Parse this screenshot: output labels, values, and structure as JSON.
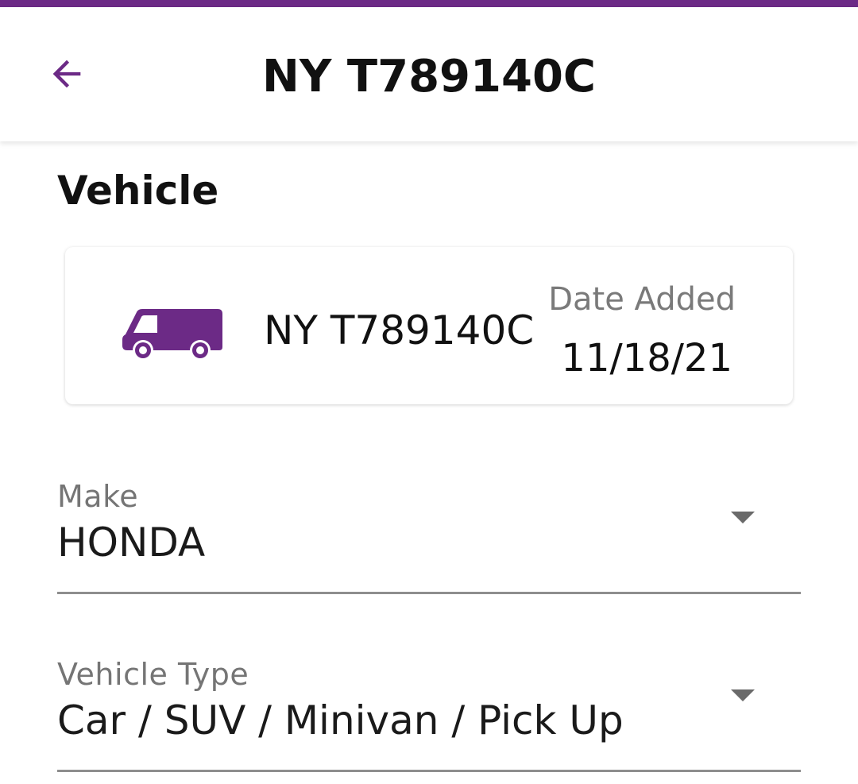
{
  "colors": {
    "brand": "#6c2a86",
    "text": "#111111",
    "muted": "#757575"
  },
  "header": {
    "back_icon": "arrow-left-icon",
    "title": "NY T789140C"
  },
  "section": {
    "title": "Vehicle"
  },
  "vehicle_card": {
    "icon": "van-icon",
    "plate": "NY T789140C",
    "date_label": "Date Added",
    "date_value": "11/18/21"
  },
  "form": {
    "make": {
      "label": "Make",
      "value": "HONDA"
    },
    "vehicle_type": {
      "label": "Vehicle Type",
      "value": "Car / SUV / Minivan / Pick Up"
    }
  }
}
